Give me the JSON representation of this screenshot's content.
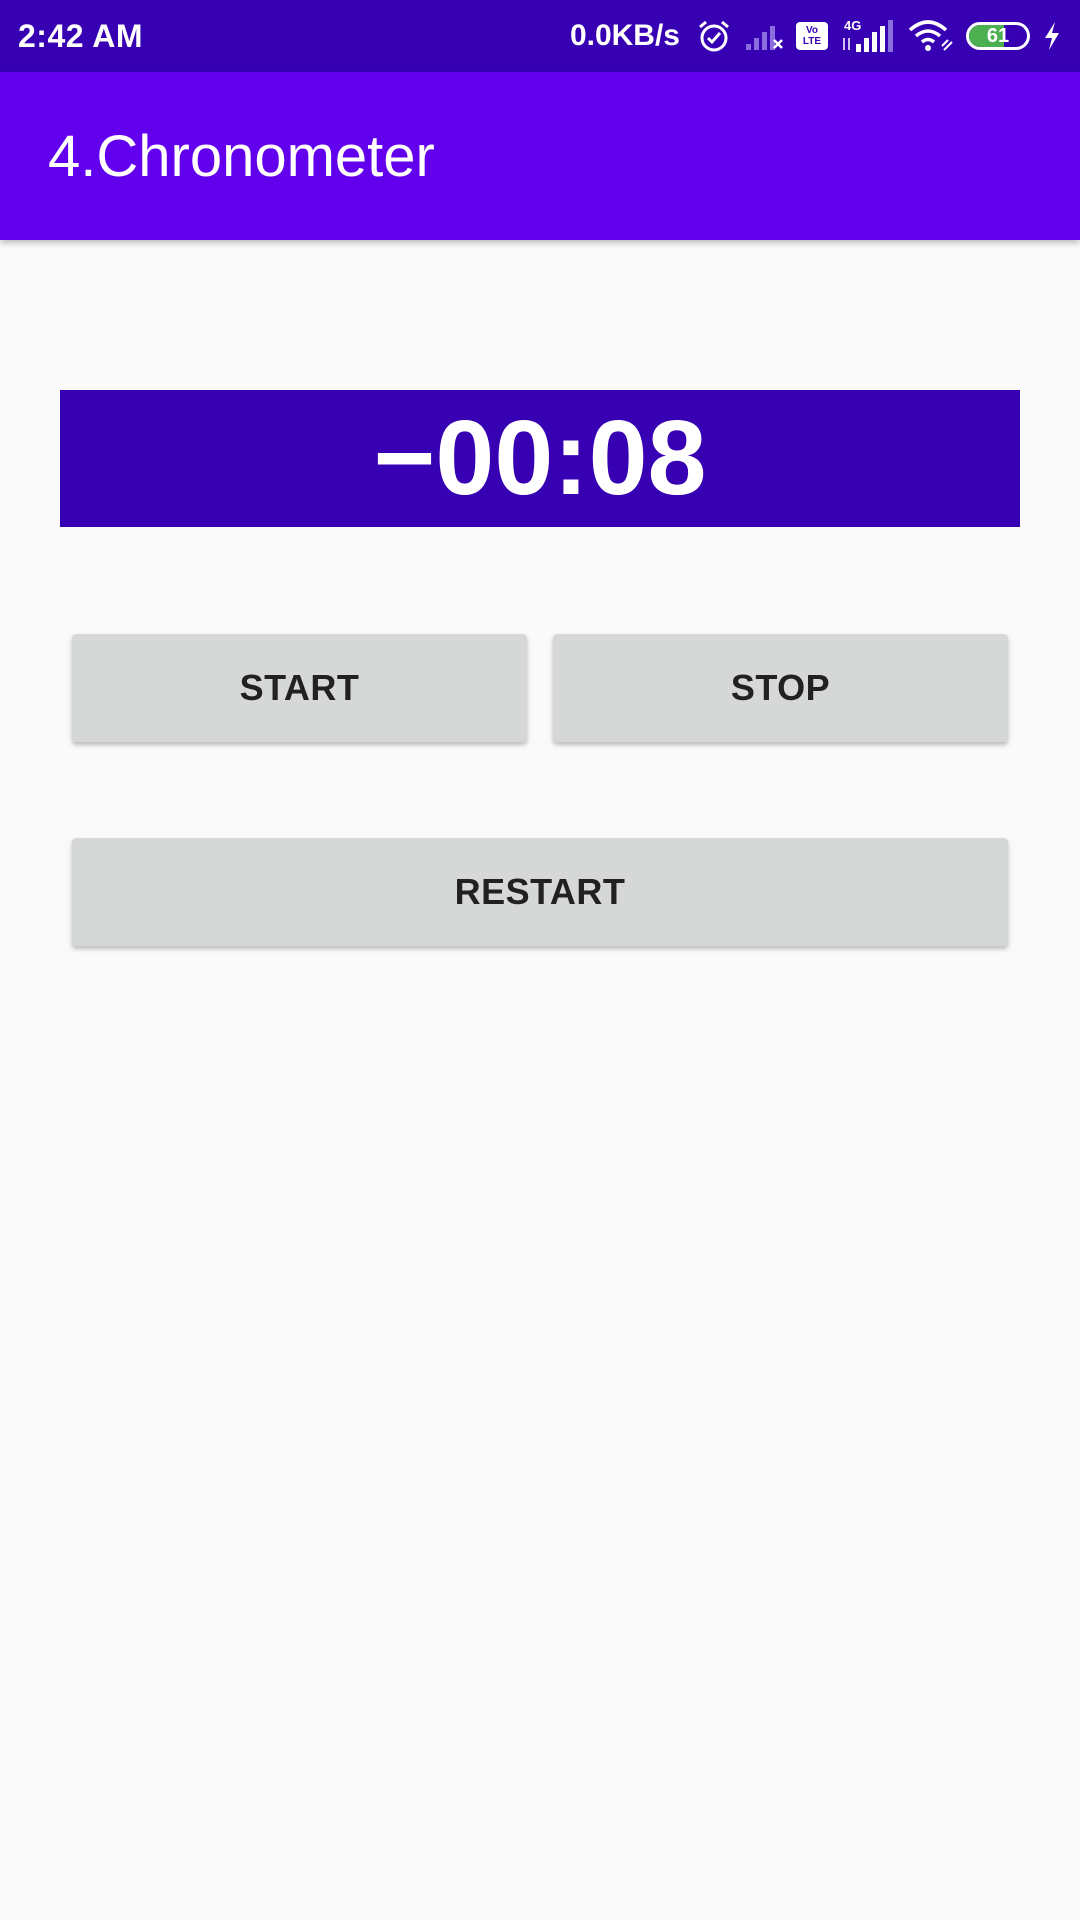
{
  "status_bar": {
    "time": "2:42 AM",
    "net_speed": "0.0KB/s",
    "volte_top": "Vo",
    "volte_bottom": "LTE",
    "network_type": "4G",
    "battery_level": "61",
    "battery_fraction": 0.61,
    "icons": [
      "alarm-icon",
      "no-signal-icon",
      "volte-icon",
      "signal-4g-icon",
      "wifi-icon",
      "battery-icon",
      "charging-icon"
    ]
  },
  "app_bar": {
    "title": "4.Chronometer"
  },
  "chronometer": {
    "value": "−00:08"
  },
  "buttons": {
    "start": "START",
    "stop": "STOP",
    "restart": "RESTART"
  },
  "colors": {
    "status_bar": "#3700b3",
    "app_bar": "#6200ee",
    "chronometer_bg": "#3700b3",
    "button_bg": "#d6d7d7",
    "background": "#fafafa"
  }
}
